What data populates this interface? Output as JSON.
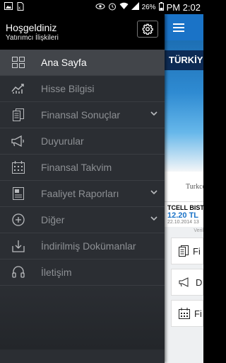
{
  "status_bar": {
    "battery": "26%",
    "time": "PM 2:02"
  },
  "drawer": {
    "header": {
      "title": "Hoşgeldiniz",
      "subtitle": "Yatırımcı İlişkileri"
    },
    "items": [
      {
        "label": "Ana Sayfa",
        "icon": "grid-icon",
        "active": true
      },
      {
        "label": "Hisse Bilgisi",
        "icon": "stock-chart-icon"
      },
      {
        "label": "Finansal Sonuçlar",
        "icon": "document-icon",
        "expandable": true
      },
      {
        "label": "Duyurular",
        "icon": "megaphone-icon"
      },
      {
        "label": "Finansal Takvim",
        "icon": "calendar-icon"
      },
      {
        "label": "Faaliyet Raporları",
        "icon": "report-icon",
        "expandable": true
      },
      {
        "label": "Diğer",
        "icon": "plus-circle-icon",
        "expandable": true
      },
      {
        "label": "İndirilmiş Dokümanlar",
        "icon": "download-icon"
      },
      {
        "label": "İletişim",
        "icon": "headset-icon"
      }
    ]
  },
  "background_app": {
    "banner_text": "TÜRKİYE'N",
    "language_text": "Turkce",
    "stock": {
      "name": "TCELL BIST",
      "price": "12.20 TL",
      "date": "22.10.2014 13"
    },
    "note": "Veril",
    "tiles": [
      {
        "label": "Fi"
      },
      {
        "label": "D"
      },
      {
        "label": "Fi"
      }
    ]
  },
  "colors": {
    "accent": "#1a73c7",
    "drawer_bg": "#2b2e33",
    "header_bg": "#000000"
  }
}
